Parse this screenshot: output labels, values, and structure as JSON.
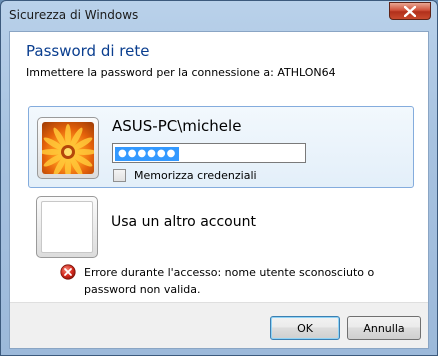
{
  "window": {
    "title": "Sicurezza di Windows"
  },
  "header": {
    "title": "Password di rete",
    "subtitle": "Immettere la password per la connessione a: ATHLON64"
  },
  "user_tile": {
    "username": "ASUS-PC\\michele",
    "password_value": "●●●●●●",
    "remember_label": "Memorizza credenziali",
    "remember_checked": false
  },
  "other_account": {
    "label": "Usa un altro account"
  },
  "error": {
    "message": "Errore durante l'accesso: nome utente sconosciuto o password non valida."
  },
  "buttons": {
    "ok": "OK",
    "cancel": "Annulla"
  },
  "icons": {
    "close": "close-icon",
    "error": "error-icon",
    "user_picture": "flower-picture-icon"
  },
  "colors": {
    "header_title": "#0a3e8f",
    "selection": "#3399ff",
    "tile_border": "#84acdd",
    "error_red": "#d42a1e"
  }
}
